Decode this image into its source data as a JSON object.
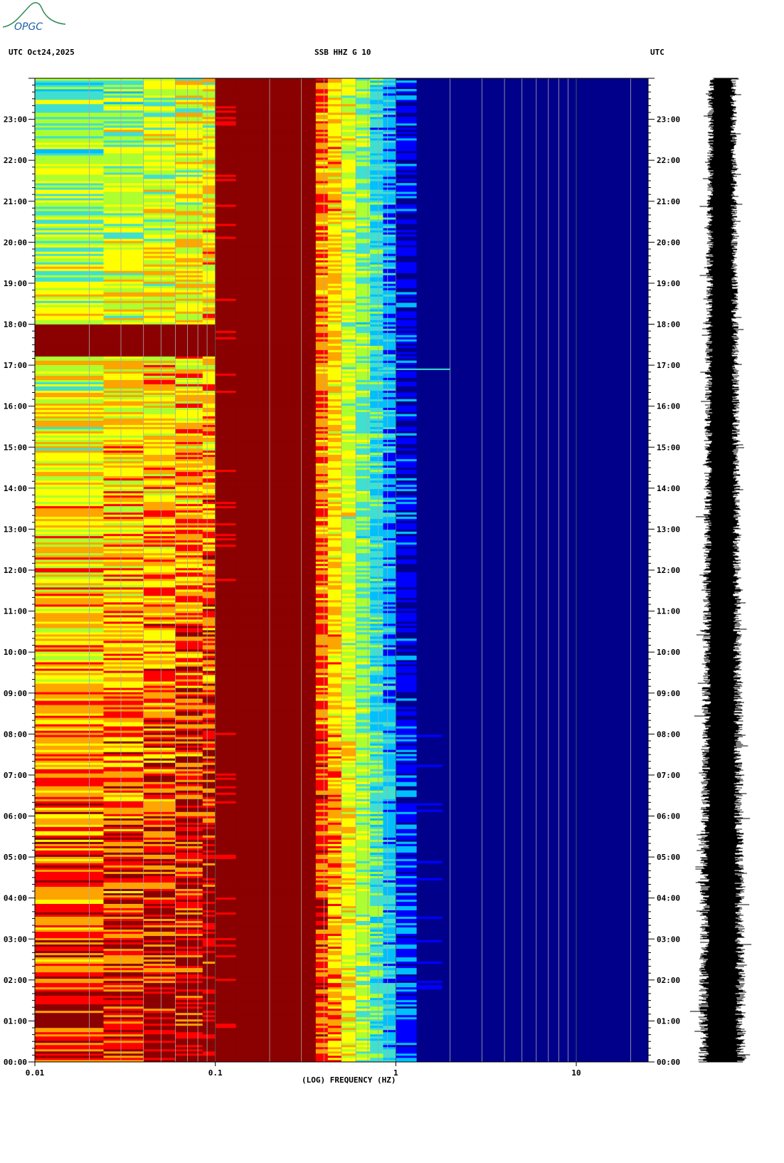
{
  "header": {
    "logo_text": "OPGC",
    "left_label": "UTC  Oct24,2025",
    "center_label": "SSB HHZ G 10",
    "right_label": "UTC"
  },
  "chart_data": {
    "type": "heatmap",
    "title": "SSB HHZ G 10",
    "date": "Oct24,2025",
    "timezone": "UTC",
    "xlabel": "(LOG) FREQUENCY (HZ)",
    "x_scale": "log",
    "xlim": [
      0.01,
      25
    ],
    "x_ticks": [
      {
        "value": 0.01,
        "label": "0.01"
      },
      {
        "value": 0.1,
        "label": "0.1"
      },
      {
        "value": 1,
        "label": "1"
      },
      {
        "value": 10,
        "label": "10"
      }
    ],
    "ylim_hours": [
      0,
      24
    ],
    "y_ticks": [
      "00:00",
      "01:00",
      "02:00",
      "03:00",
      "04:00",
      "05:00",
      "06:00",
      "07:00",
      "08:00",
      "09:00",
      "10:00",
      "11:00",
      "12:00",
      "13:00",
      "14:00",
      "15:00",
      "16:00",
      "17:00",
      "18:00",
      "19:00",
      "20:00",
      "21:00",
      "22:00",
      "23:00"
    ],
    "colormap": [
      "#00008b",
      "#0000ff",
      "#00bfff",
      "#40e0d0",
      "#adff2f",
      "#ffff00",
      "#ffa500",
      "#ff0000",
      "#8b0000"
    ],
    "notes": "Spectrogram: high power (dark red) at 0.1-0.4 Hz band at all hours; low frequencies shift from red/orange in early hours to green/cyan in later hours; above ~1 Hz mostly dark blue. Distinct event near 17:00 around 1-2 Hz."
  },
  "seismogram": {
    "label": "waveform trace"
  }
}
